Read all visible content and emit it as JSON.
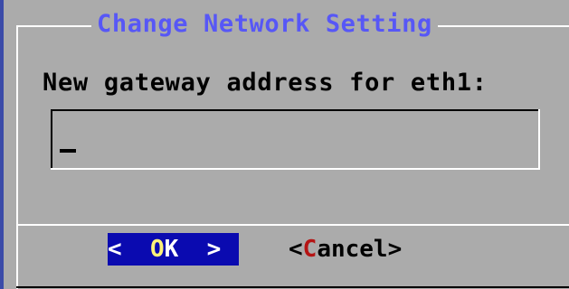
{
  "dialog": {
    "title": "Change Network Setting",
    "prompt": "New gateway address for eth1:",
    "input": {
      "value": "",
      "placeholder": ""
    }
  },
  "buttons": {
    "ok": {
      "open": "<  ",
      "hotkey": "O",
      "rest": "K",
      "close": "  >"
    },
    "cancel": {
      "open": "<",
      "hotkey": "C",
      "rest": "ancel",
      "close": ">"
    }
  },
  "colors": {
    "background": "#ababab",
    "title": "#5757f6",
    "selected_button_bg": "#0a0ab0",
    "ok_hotkey": "#fff27a",
    "cancel_hotkey": "#b51414"
  }
}
